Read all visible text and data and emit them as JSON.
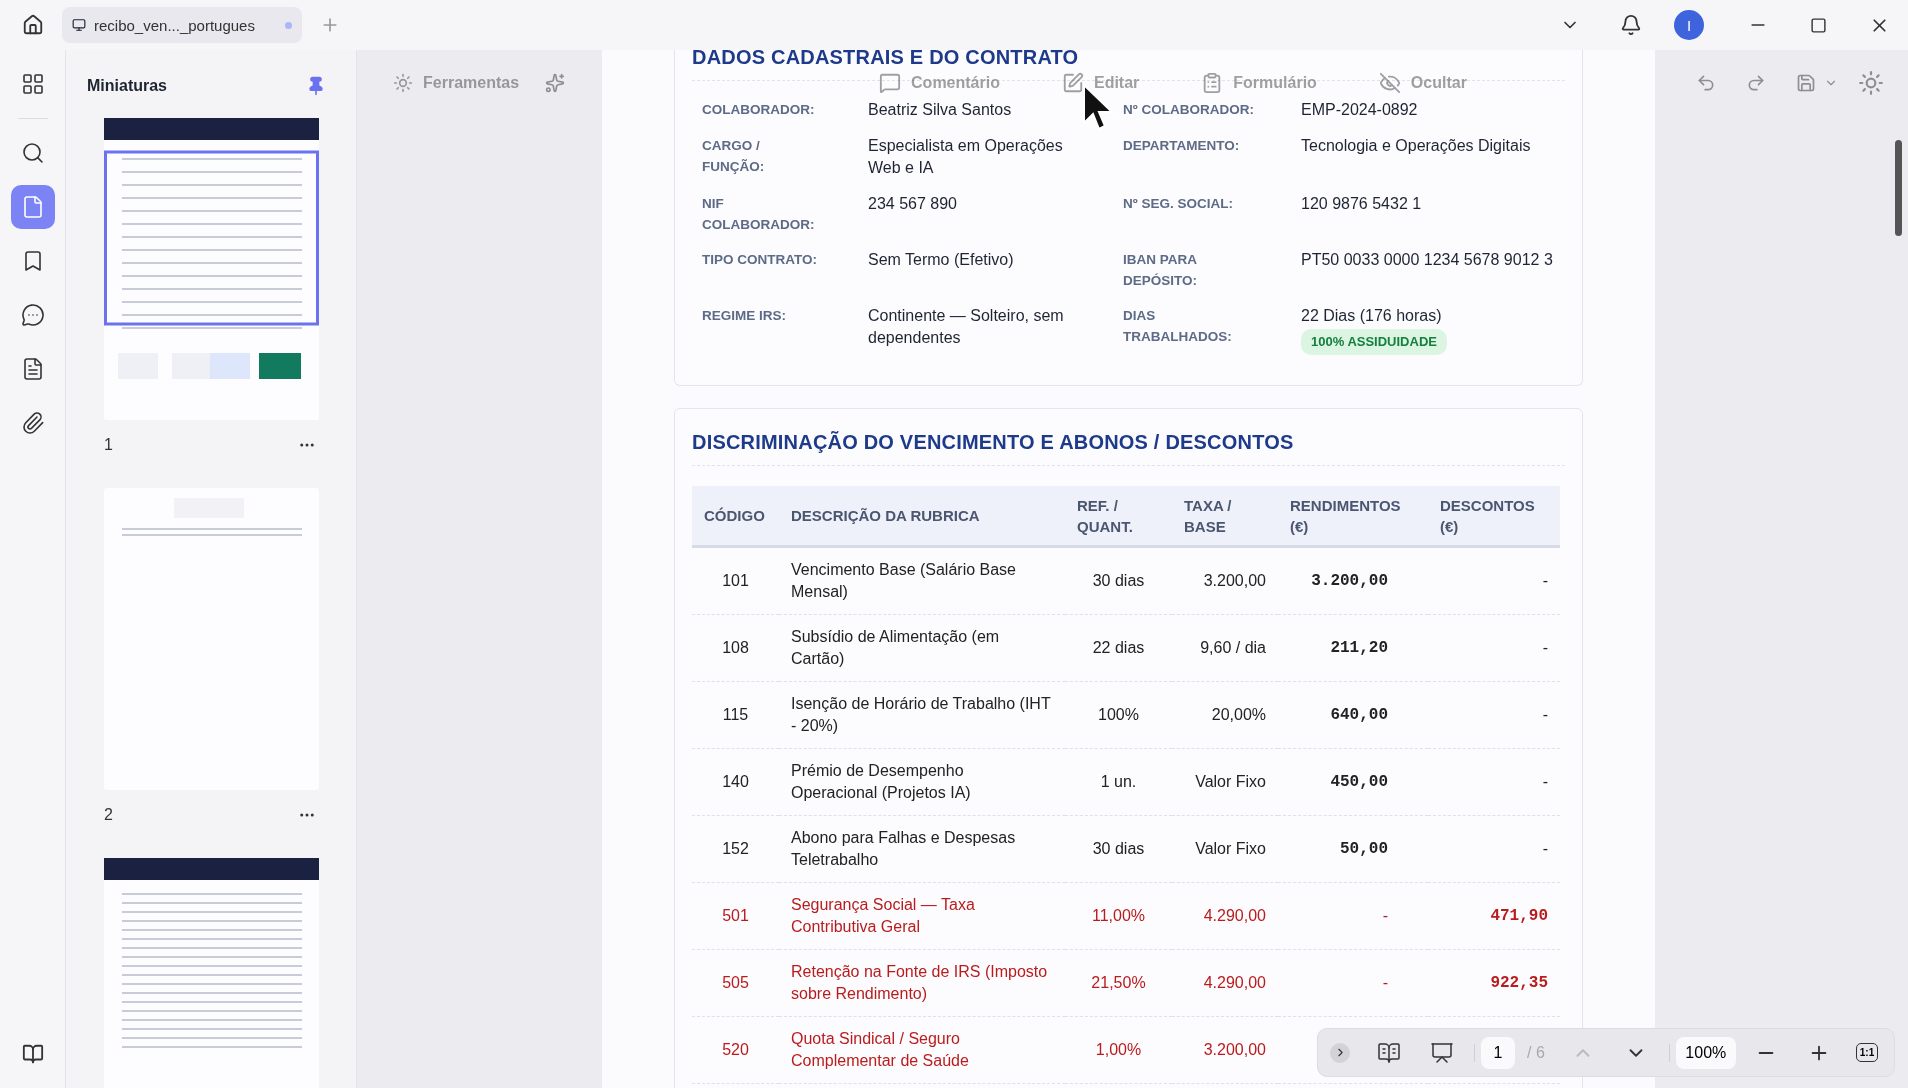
{
  "tab": {
    "title": "recibo_ven..._portugues",
    "unsaved": true
  },
  "user": {
    "initial": "I"
  },
  "rail": [
    {
      "selected": false
    },
    {
      "selected": false
    },
    {
      "selected": true
    },
    {
      "selected": false
    },
    {
      "selected": false
    },
    {
      "selected": false
    },
    {
      "selected": false
    }
  ],
  "thumbnails": {
    "title": "Miniaturas",
    "pages": [
      {
        "label": "1",
        "kind": "payslip",
        "selected": true
      },
      {
        "label": "2",
        "kind": "notes",
        "selected": false
      },
      {
        "kind": "annex",
        "selected": false
      }
    ]
  },
  "toolbar": {
    "tools": "Ferramentas",
    "items": [
      {
        "label": "Comentário"
      },
      {
        "label": "Editar"
      },
      {
        "label": "Formulário"
      },
      {
        "label": "Ocultar"
      }
    ]
  },
  "contract": {
    "title": "DADOS CADASTRAIS E DO CONTRATO",
    "fields": [
      {
        "label": "COLABORADOR:",
        "value": "Beatriz Silva Santos"
      },
      {
        "label": "Nº COLABORADOR:",
        "value": "EMP-2024-0892"
      },
      {
        "label": "CARGO / FUNÇÃO:",
        "value": "Especialista em Operações Web e IA"
      },
      {
        "label": "DEPARTAMENTO:",
        "value": "Tecnologia e Operações Digitais"
      },
      {
        "label": "NIF COLABORADOR:",
        "value": "234 567 890"
      },
      {
        "label": "Nº SEG. SOCIAL:",
        "value": "120 9876 5432 1"
      },
      {
        "label": "TIPO CONTRATO:",
        "value": "Sem Termo (Efetivo)"
      },
      {
        "label": "IBAN PARA DEPÓSITO:",
        "value": "PT50 0033 0000 1234 5678 9012 3"
      },
      {
        "label": "REGIME IRS:",
        "value": "Continente — Solteiro, sem dependentes"
      },
      {
        "label": "DIAS TRABALHADOS:",
        "value": "22 Dias (176 horas)",
        "badge": "100% ASSIDUIDADE"
      }
    ]
  },
  "breakdown": {
    "title": "DISCRIMINAÇÃO DO VENCIMENTO E ABONOS / DESCONTOS",
    "columns": [
      "CÓDIGO",
      "DESCRIÇÃO DA RUBRICA",
      "REF. / QUANT.",
      "TAXA / BASE",
      "RENDIMENTOS (€)",
      "DESCONTOS (€)"
    ],
    "rows": [
      {
        "kind": "earning",
        "code": "101",
        "description": "Vencimento Base (Salário Base Mensal)",
        "quantity": "30 dias",
        "rate": "3.200,00",
        "earnings": "3.200,00",
        "deductions": "-"
      },
      {
        "kind": "earning",
        "code": "108",
        "description": "Subsídio de Alimentação (em Cartão)",
        "quantity": "22 dias",
        "rate": "9,60 / dia",
        "earnings": "211,20",
        "deductions": "-"
      },
      {
        "kind": "earning",
        "code": "115",
        "description": "Isenção de Horário de Trabalho (IHT - 20%)",
        "quantity": "100%",
        "rate": "20,00%",
        "earnings": "640,00",
        "deductions": "-"
      },
      {
        "kind": "earning",
        "code": "140",
        "description": "Prémio de Desempenho Operacional (Projetos IA)",
        "quantity": "1 un.",
        "rate": "Valor Fixo",
        "earnings": "450,00",
        "deductions": "-"
      },
      {
        "kind": "earning",
        "code": "152",
        "description": "Abono para Falhas e Despesas Teletrabalho",
        "quantity": "30 dias",
        "rate": "Valor Fixo",
        "earnings": "50,00",
        "deductions": "-"
      },
      {
        "kind": "deduction",
        "code": "501",
        "description": "Segurança Social — Taxa Contributiva Geral",
        "quantity": "11,00%",
        "rate": "4.290,00",
        "earnings": "-",
        "deductions": "471,90"
      },
      {
        "kind": "deduction",
        "code": "505",
        "description": "Retenção na Fonte de IRS (Imposto sobre Rendimento)",
        "quantity": "21,50%",
        "rate": "4.290,00",
        "earnings": "-",
        "deductions": "922,35"
      },
      {
        "kind": "deduction",
        "code": "520",
        "description": "Quota Sindical / Seguro Complementar de Saúde",
        "quantity": "1,00%",
        "rate": "3.200,00"
      }
    ]
  },
  "pager": {
    "page": "1",
    "total": "/ 6",
    "prev_disabled": true,
    "zoom": "100%",
    "actual_size": "1:1"
  }
}
